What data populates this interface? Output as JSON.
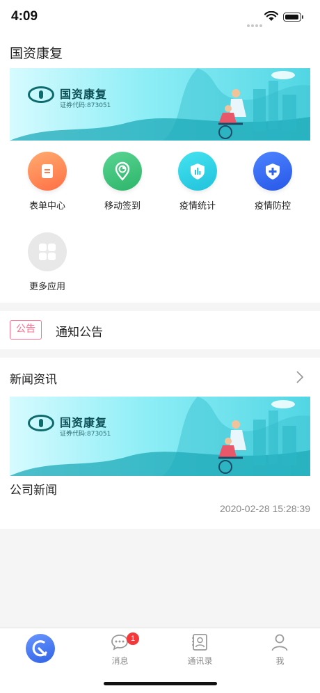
{
  "status_bar": {
    "time": "4:09"
  },
  "page": {
    "title": "国资康复"
  },
  "banner": {
    "company_name": "国资康复",
    "stock_code": "证券代码:873051"
  },
  "apps": [
    {
      "label": "表单中心",
      "icon": "form-icon",
      "color": "#ff8a5c"
    },
    {
      "label": "移动签到",
      "icon": "location-pin-icon",
      "color": "#3cc47a"
    },
    {
      "label": "疫情统计",
      "icon": "stats-shield-icon",
      "color": "#2fd0e6"
    },
    {
      "label": "疫情防控",
      "icon": "medical-shield-icon",
      "color": "#3a6cf5"
    },
    {
      "label": "更多应用",
      "icon": "grid-icon",
      "color": "#e8e8e8"
    }
  ],
  "notice": {
    "badge": "公告",
    "label": "通知公告"
  },
  "news": {
    "header": "新闻资讯",
    "items": [
      {
        "title": "公司新闻",
        "date": "2020-02-28 15:28:39"
      }
    ]
  },
  "tabbar": {
    "tabs": [
      {
        "label": "",
        "icon": "home-logo-icon",
        "active": true
      },
      {
        "label": "消息",
        "icon": "message-icon",
        "badge": "1"
      },
      {
        "label": "通讯录",
        "icon": "contacts-icon"
      },
      {
        "label": "我",
        "icon": "person-icon"
      }
    ]
  },
  "colors": {
    "accent": "#2f63e6",
    "notice": "#ff6f8f",
    "badge": "#f2383b"
  }
}
